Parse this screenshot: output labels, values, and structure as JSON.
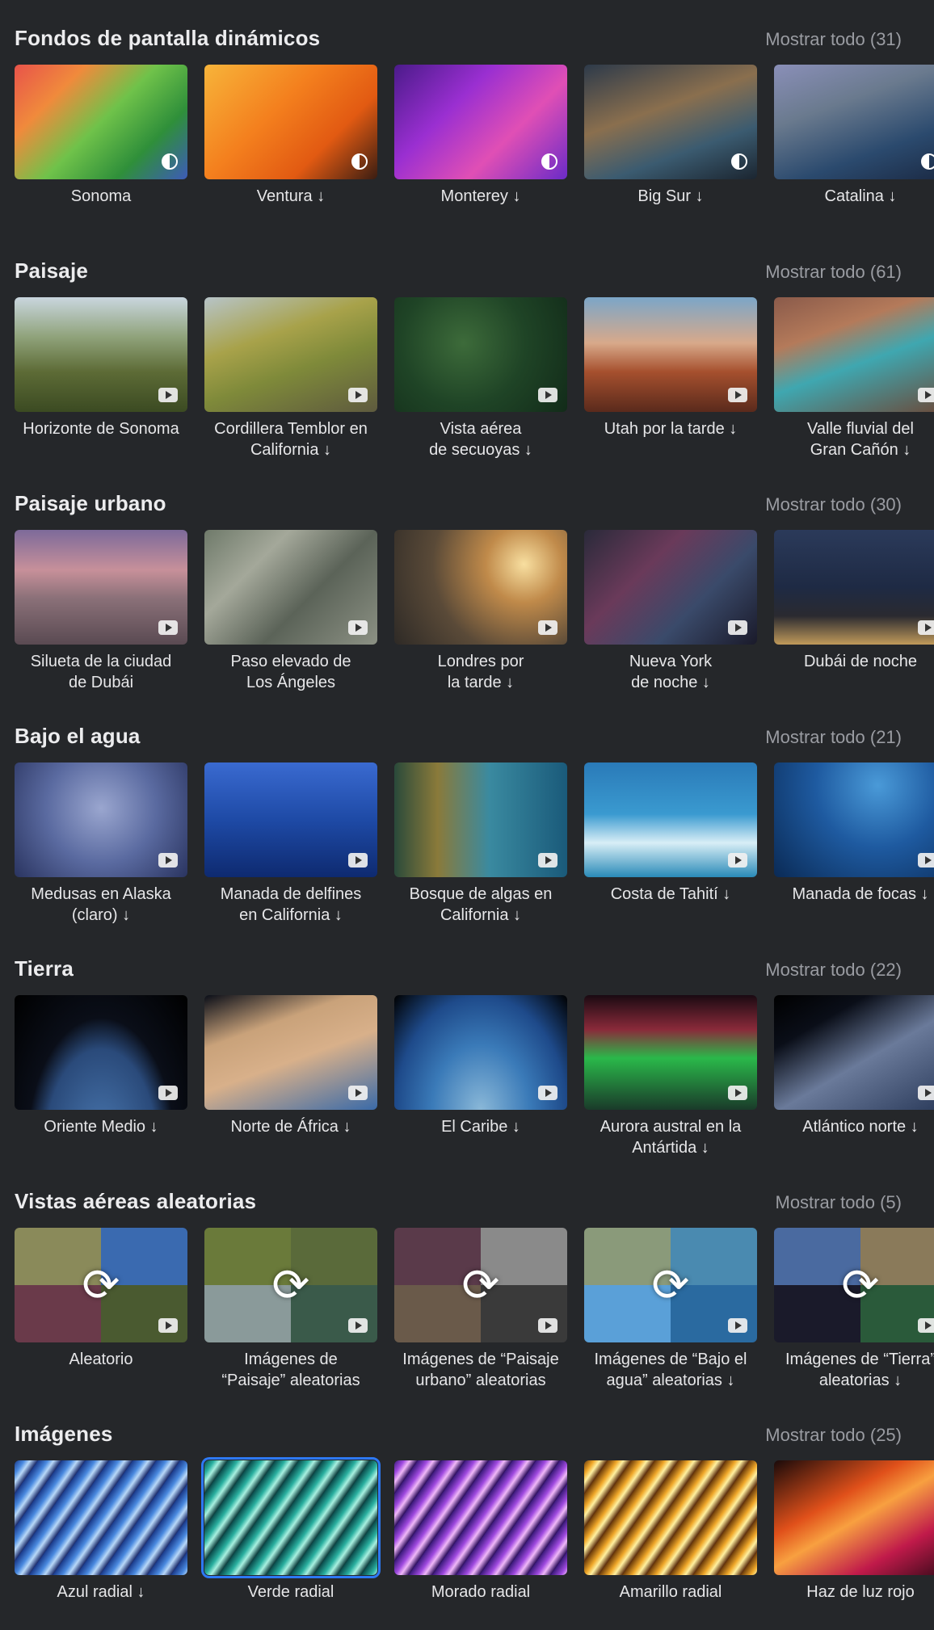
{
  "sections": [
    {
      "title": "Fondos de pantalla dinámicos",
      "show_all": "Mostrar todo (31)",
      "tiles": [
        {
          "label": "Sonoma",
          "bg": "linear-gradient(135deg,#e8534a 0%,#f08a3c 25%,#6fc24a 50%,#2f8f3a 75%,#3d5bb8 100%)",
          "badge": "dyn"
        },
        {
          "label": "Ventura ↓",
          "bg": "linear-gradient(135deg,#f7b43a 0%,#f4801e 40%,#e25a12 70%,#3a1d12 100%)",
          "badge": "dyn"
        },
        {
          "label": "Monterey ↓",
          "bg": "linear-gradient(135deg,#4b1b8a 0%,#9a2fd1 35%,#e04fb5 65%,#6a2bc7 100%)",
          "badge": "dyn"
        },
        {
          "label": "Big Sur ↓",
          "bg": "linear-gradient(160deg,#2d3a4a 0%,#8a6f4e 40%,#3b5b70 70%,#1b2530 100%)",
          "badge": "dyn"
        },
        {
          "label": "Catalina ↓",
          "bg": "linear-gradient(160deg,#8a8fb8 0%,#6a7a8e 35%,#2b4a6e 70%,#1b2a44 100%)",
          "badge": "dyn"
        }
      ]
    },
    {
      "title": "Paisaje",
      "show_all": "Mostrar todo (61)",
      "tiles": [
        {
          "label": "Horizonte de Sonoma",
          "bg": "linear-gradient(180deg,#c9d6de 0%,#8fa27a 35%,#5d6b36 65%,#3b4a22 100%)",
          "badge": "play"
        },
        {
          "label": "Cordillera Temblor en\nCalifornia ↓",
          "bg": "linear-gradient(160deg,#b7c4c8 0%,#a8a24a 35%,#7f8a3a 60%,#5e5a3e 100%)",
          "badge": "play"
        },
        {
          "label": "Vista aérea\nde secuoyas ↓",
          "bg": "radial-gradient(circle at 40% 40%,#3d6b3a 0%,#1f4426 50%,#122b19 100%)",
          "badge": "play"
        },
        {
          "label": "Utah por la tarde ↓",
          "bg": "linear-gradient(180deg,#7ba6c8 0%,#d8a98a 40%,#a6502e 65%,#5a2a1c 100%)",
          "badge": "play"
        },
        {
          "label": "Valle fluvial del\nGran Cañón ↓",
          "bg": "linear-gradient(160deg,#8a5a4a 0%,#b47a5a 30%,#3fa7b0 55%,#6b4a3a 100%)",
          "badge": "play"
        }
      ]
    },
    {
      "title": "Paisaje urbano",
      "show_all": "Mostrar todo (30)",
      "tiles": [
        {
          "label": "Silueta de la ciudad\nde Dubái",
          "bg": "linear-gradient(180deg,#7d6a9a 0%,#c7909a 35%,#8a7078 60%,#5a4a52 100%)",
          "badge": "play"
        },
        {
          "label": "Paso elevado de\nLos Ángeles",
          "bg": "linear-gradient(135deg,#6f7a6a 0%,#a4a89a 30%,#5b6358 60%,#8c9184 100%)",
          "badge": "play"
        },
        {
          "label": "Londres por\nla tarde ↓",
          "bg": "radial-gradient(circle at 75% 30%,#f8dfa0 0%,#c08a4a 25%,#5a4a38 60%,#2e2a26 100%)",
          "badge": "play"
        },
        {
          "label": "Nueva York\nde noche ↓",
          "bg": "linear-gradient(135deg,#2a2a3a 0%,#6a3a5a 35%,#3a4a6a 65%,#1a1a2a 100%)",
          "badge": "play"
        },
        {
          "label": "Dubái de noche",
          "bg": "linear-gradient(180deg,#2b3a5a 0%,#1e2a44 50%,#2a2a30 75%,#c09a5a 100%)",
          "badge": "play"
        }
      ]
    },
    {
      "title": "Bajo el agua",
      "show_all": "Mostrar todo (21)",
      "tiles": [
        {
          "label": "Medusas en Alaska\n(claro) ↓",
          "bg": "radial-gradient(circle at 50% 40%,#9aa6cf 0%,#5a6aa0 50%,#2a3460 100%)",
          "badge": "play"
        },
        {
          "label": "Manada de delfines\nen California ↓",
          "bg": "linear-gradient(180deg,#3a6ad0 0%,#1e4aa6 50%,#0e2a70 100%)",
          "badge": "play"
        },
        {
          "label": "Bosque de algas en\nCalifornia ↓",
          "bg": "linear-gradient(90deg,#2a4a3a 0%,#8a7a3a 25%,#3a8aa0 55%,#1a5a7a 100%)",
          "badge": "play"
        },
        {
          "label": "Costa de Tahití ↓",
          "bg": "linear-gradient(180deg,#2a7ab8 0%,#3a9ad0 45%,#d8eef6 70%,#2a8ab8 100%)",
          "badge": "play"
        },
        {
          "label": "Manada de focas ↓",
          "bg": "radial-gradient(circle at 60% 20%,#4a9ad8 0%,#1e5aa0 45%,#0a2a55 100%)",
          "badge": "play"
        }
      ]
    },
    {
      "title": "Tierra",
      "show_all": "Mostrar todo (22)",
      "tiles": [
        {
          "label": "Oriente Medio ↓",
          "bg": "radial-gradient(ellipse at 50% 130%,#4a78b0 0%,#2a4a7a 45%,#0a0e18 60%,#000 100%)",
          "badge": "play"
        },
        {
          "label": "Norte de África ↓",
          "bg": "linear-gradient(160deg,#0a0e18 0%,#c9a27a 30%,#d8b08a 55%,#3a6aa8 100%)",
          "badge": "play"
        },
        {
          "label": "El Caribe ↓",
          "bg": "radial-gradient(ellipse at 50% 100%,#8ab8d8 0%,#3a7ab8 40%,#1e4a8a 70%,#000 100%)",
          "badge": "play"
        },
        {
          "label": "Aurora austral en la\nAntártida ↓",
          "bg": "linear-gradient(180deg,#1a0a12 0%,#8a2a3a 30%,#2ab84a 55%,#1a3a2a 100%)",
          "badge": "play"
        },
        {
          "label": "Atlántico norte ↓",
          "bg": "linear-gradient(150deg,#000 0%,#0a0e18 25%,#6a7a9a 55%,#2a3a5a 100%)",
          "badge": "play"
        }
      ]
    },
    {
      "title": "Vistas aéreas aleatorias",
      "show_all": "Mostrar todo (5)",
      "tiles": [
        {
          "label": "Aleatorio",
          "quads": [
            "#8a8a5a",
            "#3a6ab0",
            "#6a3a4a",
            "#4a5a30"
          ],
          "badge": "play",
          "shuffle": "⟳"
        },
        {
          "label": "Imágenes de\n“Paisaje” aleatorias",
          "quads": [
            "#6a7a3a",
            "#5a6a3a",
            "#8a9a9a",
            "#3a5a4a"
          ],
          "badge": "play",
          "shuffle": "⟳"
        },
        {
          "label": "Imágenes de “Paisaje\nurbano” aleatorias",
          "quads": [
            "#5a3a4a",
            "#8a8a8a",
            "#6a5a4a",
            "#3a3a3a"
          ],
          "badge": "play",
          "shuffle": "⟳"
        },
        {
          "label": "Imágenes de “Bajo el\nagua” aleatorias ↓",
          "quads": [
            "#8a9a7a",
            "#4a8ab0",
            "#5aa0d8",
            "#2a6aa0"
          ],
          "badge": "play",
          "shuffle": "⟳"
        },
        {
          "label": "Imágenes de “Tierra”\naleatorias ↓",
          "quads": [
            "#4a6aa0",
            "#8a7a5a",
            "#1a1a2a",
            "#2a5a3a"
          ],
          "badge": "play",
          "shuffle": "⟳"
        }
      ]
    },
    {
      "title": "Imágenes",
      "show_all": "Mostrar todo (25)",
      "tiles": [
        {
          "label": "Azul radial ↓",
          "bg": "repeating-linear-gradient(125deg,#1a3a8a 0px,#4a8ae0 10px,#b8d8f8 16px,#1a2a6a 24px)",
          "badge": ""
        },
        {
          "label": "Verde radial",
          "bg": "repeating-linear-gradient(125deg,#0a4a4a 0px,#2ab0a0 10px,#a8f0e0 16px,#0a3a3a 24px)",
          "badge": "",
          "selected": true
        },
        {
          "label": "Morado radial",
          "bg": "repeating-linear-gradient(125deg,#3a1a7a 0px,#a04ae0 10px,#f0b8f8 16px,#2a0a5a 24px)",
          "badge": ""
        },
        {
          "label": "Amarillo radial",
          "bg": "repeating-linear-gradient(125deg,#6a3a0a 0px,#f0a82a 10px,#fff0a0 16px,#5a2a0a 24px)",
          "badge": ""
        },
        {
          "label": "Haz de luz rojo",
          "bg": "linear-gradient(150deg,#1a0a0a 0%,#e0501a 35%,#f8a040 50%,#c01a4a 75%,#3a0a1a 100%)",
          "badge": ""
        }
      ]
    }
  ]
}
